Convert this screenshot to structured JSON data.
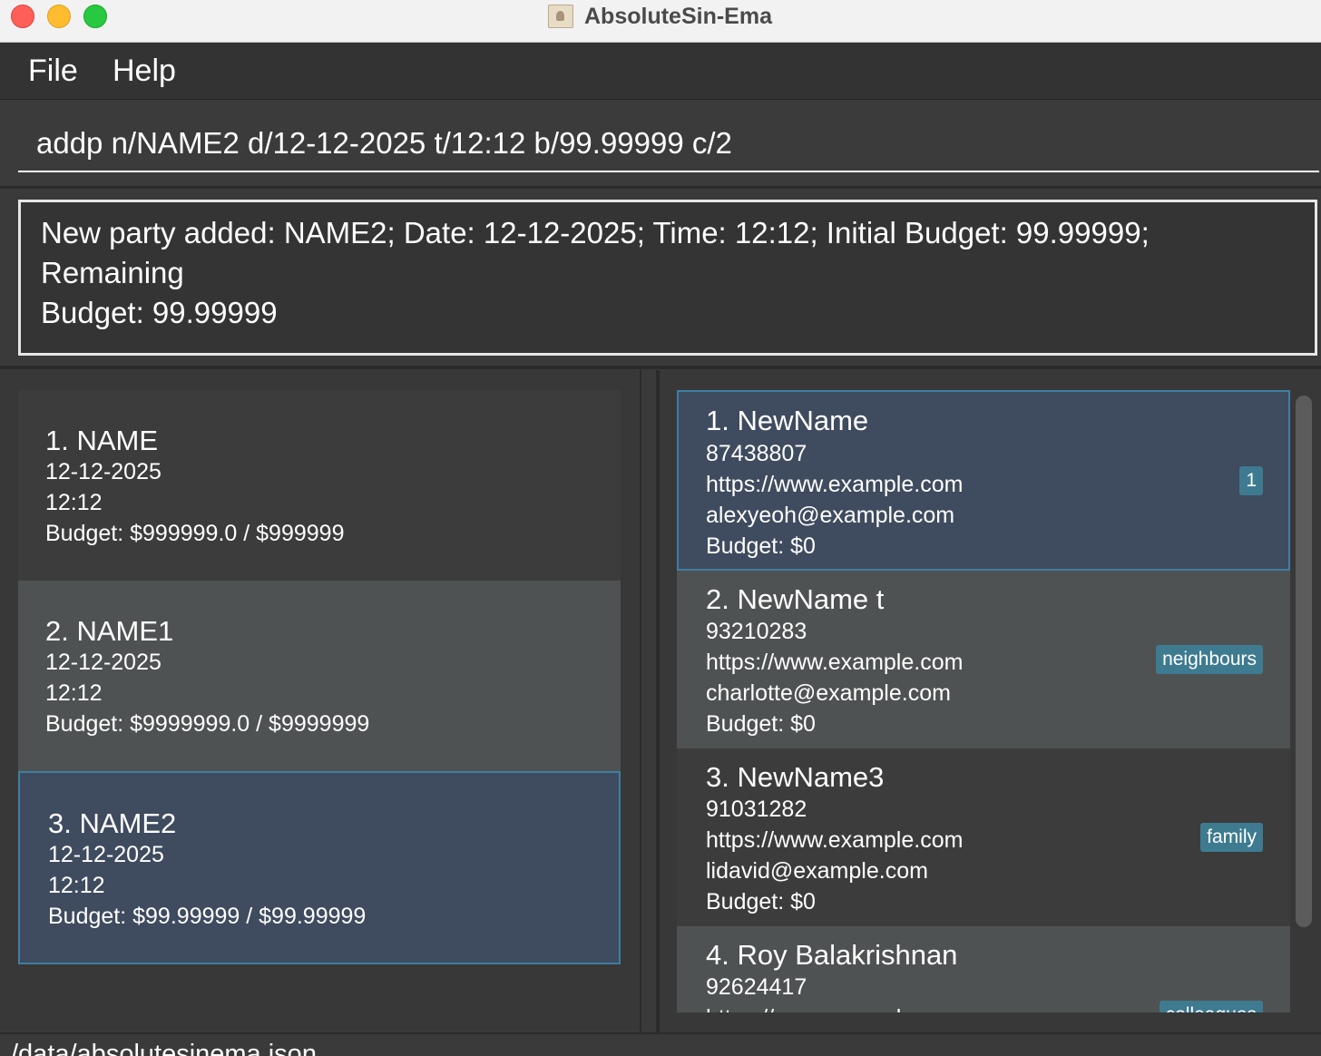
{
  "window": {
    "title": "AbsoluteSin-Ema"
  },
  "menu": {
    "file": "File",
    "help": "Help"
  },
  "command": {
    "value": "addp n/NAME2 d/12-12-2025 t/12:12 b/99.99999 c/2"
  },
  "result": {
    "line1": "New party added: NAME2; Date: 12-12-2025; Time: 12:12; Initial Budget: 99.99999; Remaining",
    "line2": "Budget: 99.99999"
  },
  "parties": [
    {
      "name": "1. NAME",
      "date": "12-12-2025",
      "time": "12:12",
      "budget": "Budget: $999999.0 / $999999"
    },
    {
      "name": "2. NAME1",
      "date": "12-12-2025",
      "time": "12:12",
      "budget": "Budget: $9999999.0 / $9999999"
    },
    {
      "name": "3. NAME2",
      "date": "12-12-2025",
      "time": "12:12",
      "budget": "Budget: $99.99999 / $99.99999"
    }
  ],
  "persons": [
    {
      "name": "1. NewName",
      "phone": "87438807",
      "website": "https://www.example.com",
      "email": "alexyeoh@example.com",
      "budget": "Budget: $0",
      "tag": "1"
    },
    {
      "name": "2. NewName t",
      "phone": "93210283",
      "website": "https://www.example.com",
      "email": "charlotte@example.com",
      "budget": "Budget: $0",
      "tag": "neighbours"
    },
    {
      "name": "3. NewName3",
      "phone": "91031282",
      "website": "https://www.example.com",
      "email": "lidavid@example.com",
      "budget": "Budget: $0",
      "tag": "family"
    },
    {
      "name": "4. Roy Balakrishnan",
      "phone": "92624417",
      "website": "https://www.example.com",
      "email": "",
      "budget": "",
      "tag": "colleagues"
    }
  ],
  "status": {
    "path": "/data/absolutesinema.json"
  },
  "colors": {
    "accent": "#3d7fa3",
    "tag": "#3e7b91",
    "selected_bg": "#3f4b5e"
  }
}
